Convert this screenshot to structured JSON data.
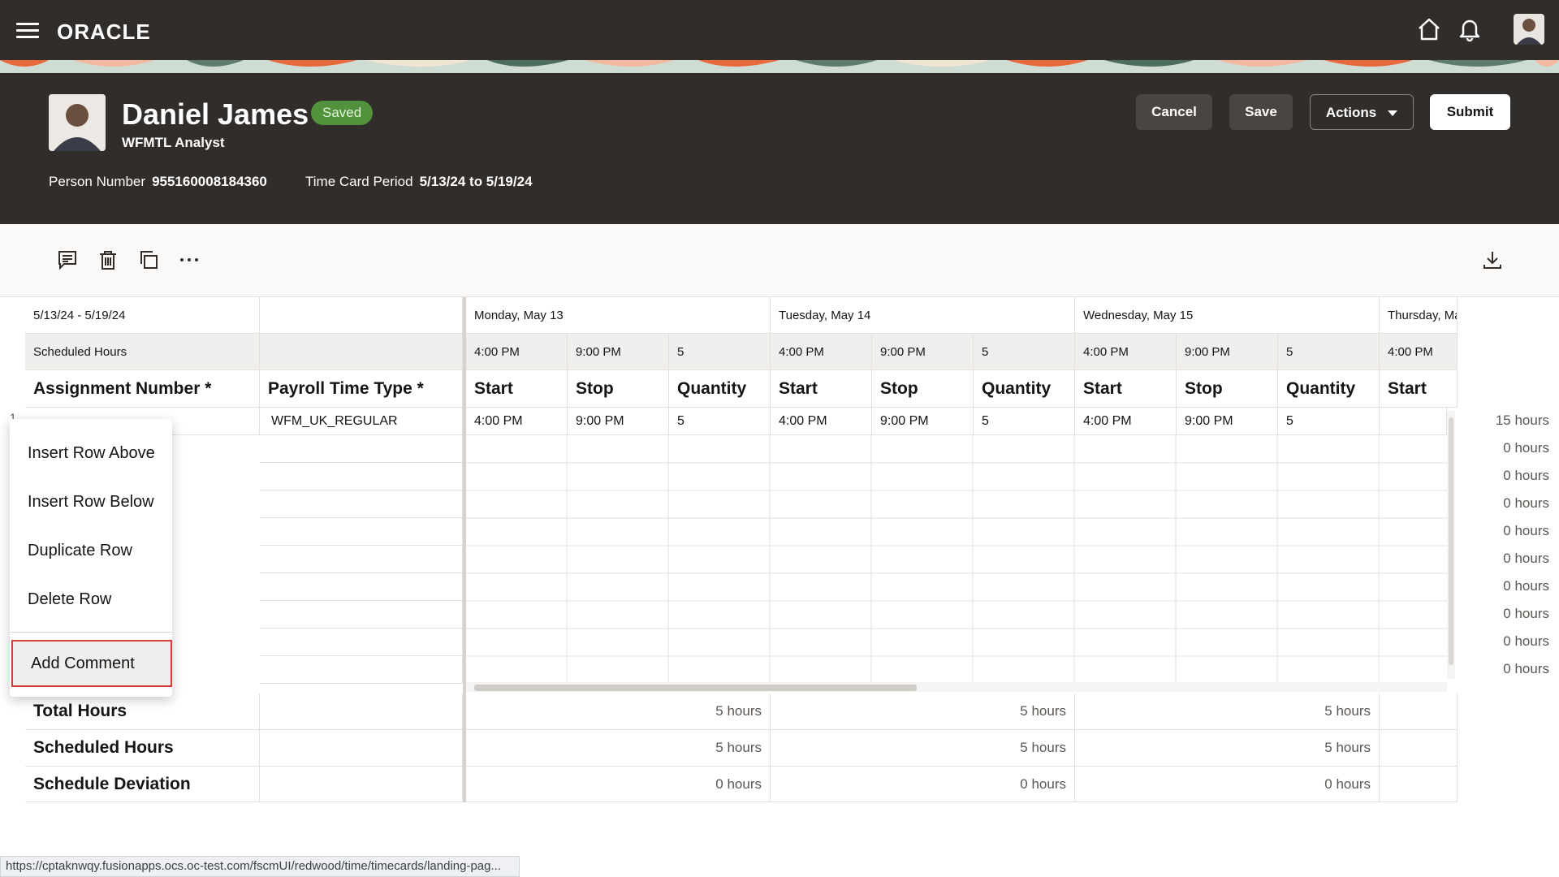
{
  "app": {
    "logo": "ORACLE"
  },
  "header": {
    "name": "Daniel James",
    "status": "Saved",
    "job_title": "WFMTL Analyst",
    "person_number_label": "Person Number",
    "person_number": "955160008184360",
    "period_label": "Time Card Period",
    "period": "5/13/24 to 5/19/24",
    "buttons": {
      "cancel": "Cancel",
      "save": "Save",
      "actions": "Actions",
      "submit": "Submit"
    }
  },
  "grid": {
    "period": "5/13/24 - 5/19/24",
    "scheduled_label": "Scheduled Hours",
    "col_assignment": "Assignment Number *",
    "col_payroll": "Payroll Time Type *",
    "days": [
      {
        "label": "Monday, May 13",
        "sched_start": "4:00 PM",
        "sched_stop": "9:00 PM",
        "sched_qty": "5"
      },
      {
        "label": "Tuesday, May 14",
        "sched_start": "4:00 PM",
        "sched_stop": "9:00 PM",
        "sched_qty": "5"
      },
      {
        "label": "Wednesday, May 15",
        "sched_start": "4:00 PM",
        "sched_stop": "9:00 PM",
        "sched_qty": "5"
      },
      {
        "label": "Thursday, Ma",
        "sched_start": "4:00 PM"
      }
    ],
    "sub_headers": {
      "start": "Start",
      "stop": "Stop",
      "quantity": "Quantity"
    },
    "row1": {
      "payroll": "WFM_UK_REGULAR",
      "mon": {
        "start": "4:00 PM",
        "stop": "9:00 PM",
        "qty": "5"
      },
      "tue": {
        "start": "4:00 PM",
        "stop": "9:00 PM",
        "qty": "5"
      },
      "wed": {
        "start": "4:00 PM",
        "stop": "9:00 PM",
        "qty": "5"
      }
    },
    "row_totals": [
      "15 hours",
      "0 hours",
      "0 hours",
      "0 hours",
      "0 hours",
      "0 hours",
      "0 hours",
      "0 hours",
      "0 hours",
      "0 hours"
    ],
    "totals": {
      "total_hours_label": "Total Hours",
      "scheduled_hours_label": "Scheduled Hours",
      "deviation_label": "Schedule Deviation",
      "total": [
        "5 hours",
        "5 hours",
        "5 hours"
      ],
      "scheduled": [
        "5 hours",
        "5 hours",
        "5 hours"
      ],
      "deviation": [
        "0 hours",
        "0 hours",
        "0 hours"
      ]
    }
  },
  "context_menu": {
    "items": [
      "Insert Row Above",
      "Insert Row Below",
      "Duplicate Row",
      "Delete Row"
    ],
    "selected": "Add Comment"
  },
  "status_url": "https://cptaknwqy.fusionapps.ocs.oc-test.com/fscmUI/redwood/time/timecards/landing-pag..."
}
